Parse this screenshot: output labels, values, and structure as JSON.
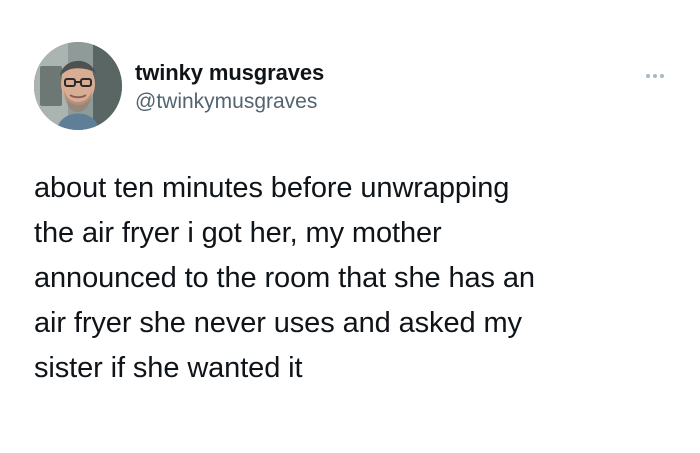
{
  "author": {
    "display_name": "twinky musgraves",
    "handle": "@twinkymusgraves",
    "avatar_icon": "profile-photo-icon"
  },
  "menu": {
    "icon": "more-options-icon"
  },
  "tweet": {
    "text_lines": [
      "about ten minutes before unwrapping",
      "the air fryer i got her, my mother",
      "announced to the room that she has an",
      "air fryer she never uses and asked my",
      "sister if she wanted it"
    ]
  },
  "colors": {
    "text": "#0f1419",
    "secondary_text": "#536471",
    "menu_dots": "#aab8c2",
    "background": "#ffffff"
  }
}
